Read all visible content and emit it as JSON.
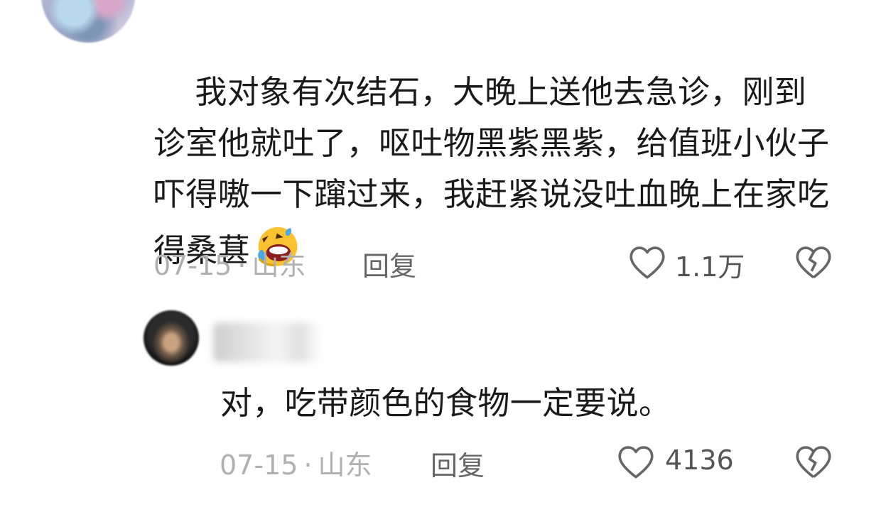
{
  "comments": [
    {
      "text": "我对象有次结石，大晚上送他去急诊，刚到诊室他就吐了，呕吐物黑紫黑紫，给值班小伙子吓得嗷一下蹿过来，我赶紧说没吐血晚上在家吃得桑葚",
      "emoji": "rolling-on-floor-laughing-emoji",
      "date": "07-15",
      "location": "山东",
      "reply_label": "回复",
      "like_count": "1.1万"
    },
    {
      "text": "对，吃带颜色的食物一定要说。",
      "date": "07-15",
      "location": "山东",
      "reply_label": "回复",
      "like_count": "4136"
    }
  ],
  "meta_separator": "·",
  "icons": {
    "like": "heart-outline-icon",
    "dislike": "broken-heart-icon"
  },
  "colors": {
    "text": "#1a1a1a",
    "meta": "#b0b0b0",
    "action": "#666666"
  }
}
